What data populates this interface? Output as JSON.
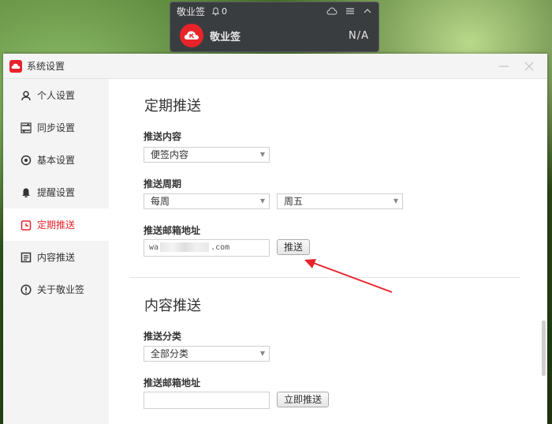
{
  "widget": {
    "title": "敬业签",
    "bell_count": "0",
    "app_name": "敬业签",
    "status": "N/A"
  },
  "window": {
    "title": "系统设置"
  },
  "sidebar": {
    "items": [
      {
        "label": "个人设置",
        "icon": "person-icon"
      },
      {
        "label": "同步设置",
        "icon": "sync-icon"
      },
      {
        "label": "基本设置",
        "icon": "settings-icon"
      },
      {
        "label": "提醒设置",
        "icon": "bell-icon"
      },
      {
        "label": "定期推送",
        "icon": "calendar-icon",
        "active": true
      },
      {
        "label": "内容推送",
        "icon": "document-icon"
      },
      {
        "label": "关于敬业签",
        "icon": "info-icon"
      }
    ]
  },
  "periodic": {
    "title": "定期推送",
    "content_label": "推送内容",
    "content_value": "便签内容",
    "cycle_label": "推送周期",
    "cycle_value": "每周",
    "day_value": "周五",
    "email_label": "推送邮箱地址",
    "email_prefix": "wa",
    "email_suffix": ".com",
    "push_button": "推送"
  },
  "content_push": {
    "title": "内容推送",
    "category_label": "推送分类",
    "category_value": "全部分类",
    "email_label": "推送邮箱地址",
    "email_value": "",
    "push_now_button": "立即推送"
  },
  "colors": {
    "accent": "#e8232a",
    "annotation_arrow": "#e8232a"
  }
}
